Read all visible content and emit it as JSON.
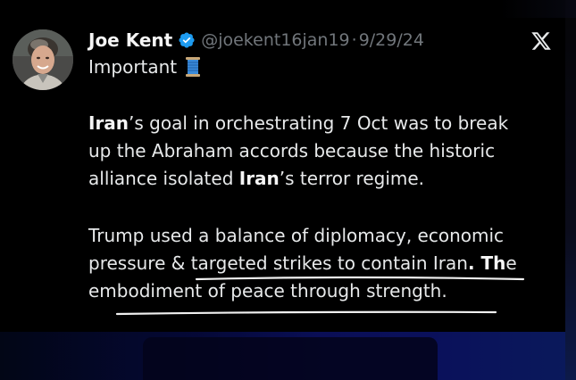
{
  "tweet": {
    "author": {
      "display_name": "Joe Kent",
      "handle": "@joekent16jan19",
      "date": "9/29/24",
      "verified": true
    },
    "separator": "·",
    "subtitle": "Important",
    "subtitle_icon": "thread-spool-icon",
    "paragraph1": {
      "line1": {
        "bold": "Iran",
        "rest": "’s goal in orchestrating 7 Oct was to break"
      },
      "line2": "up the Abraham accords because the historic",
      "line3": {
        "pre": "alliance isolated ",
        "bold": "Iran",
        "post": "’s terror regime."
      }
    },
    "paragraph2": {
      "line1": "Trump used a balance of diplomacy, economic",
      "line2": {
        "pre": "pressure & targeted strikes to contain Iran",
        "bold": ". Th",
        "post": "e"
      },
      "line3": "embodiment of peace through strength."
    },
    "platform_icon": "x-logo-icon"
  },
  "colors": {
    "background": "#000000",
    "text": "#e7e9ea",
    "muted": "#71767b",
    "verified": "#1d9bf0",
    "annotation": "#f0f0f0"
  }
}
